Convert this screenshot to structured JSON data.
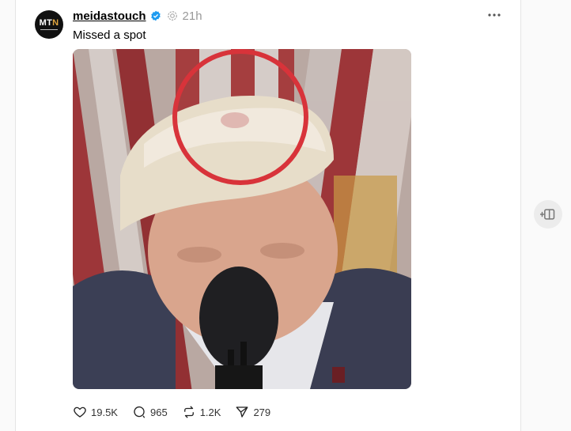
{
  "post": {
    "avatar_text_mt": "MT",
    "avatar_text_n": "N",
    "username": "meidastouch",
    "timestamp": "21h",
    "caption": "Missed a spot",
    "icon_verified": "verified-badge-icon",
    "icon_more": "more-icon"
  },
  "actions": {
    "likes": "19.5K",
    "replies": "965",
    "reposts": "1.2K",
    "shares": "279"
  },
  "colors": {
    "verified": "#1d9bf0",
    "circle": "#d8333a"
  }
}
